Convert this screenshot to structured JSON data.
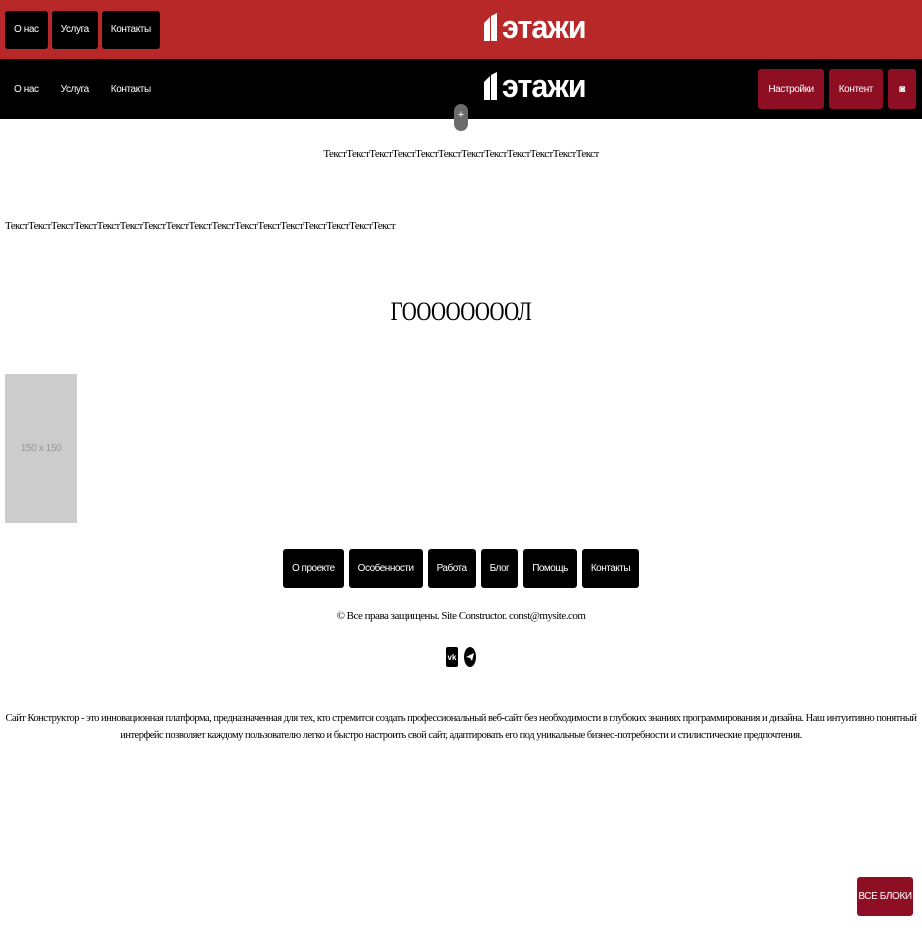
{
  "header_red": {
    "nav": [
      "О нас",
      "Услуга",
      "Контакты"
    ],
    "logo": "этажи"
  },
  "header_black": {
    "nav": [
      "О нас",
      "Услуга",
      "Контакты"
    ],
    "logo": "этажи",
    "actions": {
      "settings": "Настройки",
      "content": "Контент",
      "icon": "◙"
    }
  },
  "add_handle": "+",
  "text_center": "ТекстТекстТекстТекстТекстТекстТекстТекстТекстТекстТекстТекст",
  "text_left": "ТекстТекстТекстТекстТекстТекстТекстТекстТекстТекстТекстТекстТекстТекстТекстТекстТекст",
  "heading": "ГООООООООЛ",
  "placeholder_label": "150 x 150",
  "footer_nav": [
    "О проекте",
    "Особенности",
    "Работа",
    "Блог",
    "Помощь",
    "Контакты"
  ],
  "copyright": "© Все права защищены. Site Constructor. const@mysite.com",
  "socials": {
    "vk": "vk",
    "telegram": "tg"
  },
  "description": "Сайт Конструктор - это инновационная платформа, предназначенная для тех, кто стремится создать профессиональный веб-сайт без необходимости в глубоких знаниях программирования и дизайна. Наш интуитивно понятный интерфейс позволяет каждому пользователю легко и быстро настроить свой сайт, адаптировать его под уникальные бизнес-потребности и стилистические предпочтения.",
  "all_blocks": "ВСЕ БЛОКИ",
  "colors": {
    "header_red": "#b82829",
    "header_black": "#000000",
    "accent": "#8e0f24",
    "placeholder": "#cccccc"
  }
}
